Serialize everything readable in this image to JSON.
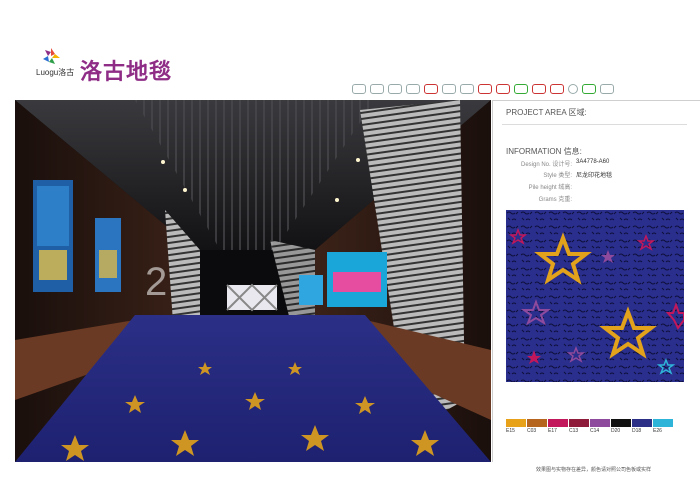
{
  "header": {
    "logo_word": "Luogu洛古",
    "brand_title": "洛古地毯"
  },
  "certifications": [
    {
      "icon": "cert-badge-icon",
      "style": "gray"
    },
    {
      "icon": "cert-badge-icon",
      "style": "gray"
    },
    {
      "icon": "cert-badge-icon",
      "style": "gray"
    },
    {
      "icon": "cert-badge-icon",
      "style": "gray"
    },
    {
      "icon": "cert-badge-icon",
      "style": "red"
    },
    {
      "icon": "cert-badge-icon",
      "style": "gray"
    },
    {
      "icon": "cert-badge-icon",
      "style": "gray"
    },
    {
      "icon": "cert-badge-icon",
      "style": "red"
    },
    {
      "icon": "cert-badge-icon",
      "style": "red"
    },
    {
      "icon": "cert-badge-icon",
      "style": "green"
    },
    {
      "icon": "cert-badge-icon",
      "style": "red"
    },
    {
      "icon": "cert-badge-icon",
      "style": "red"
    },
    {
      "icon": "cert-badge-icon",
      "style": "round"
    },
    {
      "icon": "cert-badge-icon",
      "style": "green"
    },
    {
      "icon": "cert-badge-icon",
      "style": "gray"
    }
  ],
  "panel": {
    "project_area": "PROJECT AREA 区域:",
    "information": "INFORMATION 信息:",
    "fields": [
      {
        "label": "Design No. 设计号:",
        "value": "3A4778-A60"
      },
      {
        "label": "Style 类型:",
        "value": "尼龙印花地毯"
      },
      {
        "label": "Pile height 绒高:",
        "value": ""
      },
      {
        "label": "Grams 克重:",
        "value": ""
      }
    ]
  },
  "colors": [
    {
      "code": "E15",
      "hex": "#e8a21a"
    },
    {
      "code": "C03",
      "hex": "#b5651d"
    },
    {
      "code": "E17",
      "hex": "#c2185b"
    },
    {
      "code": "C13",
      "hex": "#8e1b3a"
    },
    {
      "code": "C14",
      "hex": "#8e4a9c"
    },
    {
      "code": "D20",
      "hex": "#111111"
    },
    {
      "code": "D18",
      "hex": "#2b2f86"
    },
    {
      "code": "E26",
      "hex": "#2fb4d9"
    }
  ],
  "footer": {
    "note": "效果图与实物存在差异，颜色请对照公司色板或实样"
  },
  "theme": {
    "brand_purple": "#8e2c86",
    "carpet_blue": "#22247a",
    "star_gold": "#e2a21b"
  }
}
